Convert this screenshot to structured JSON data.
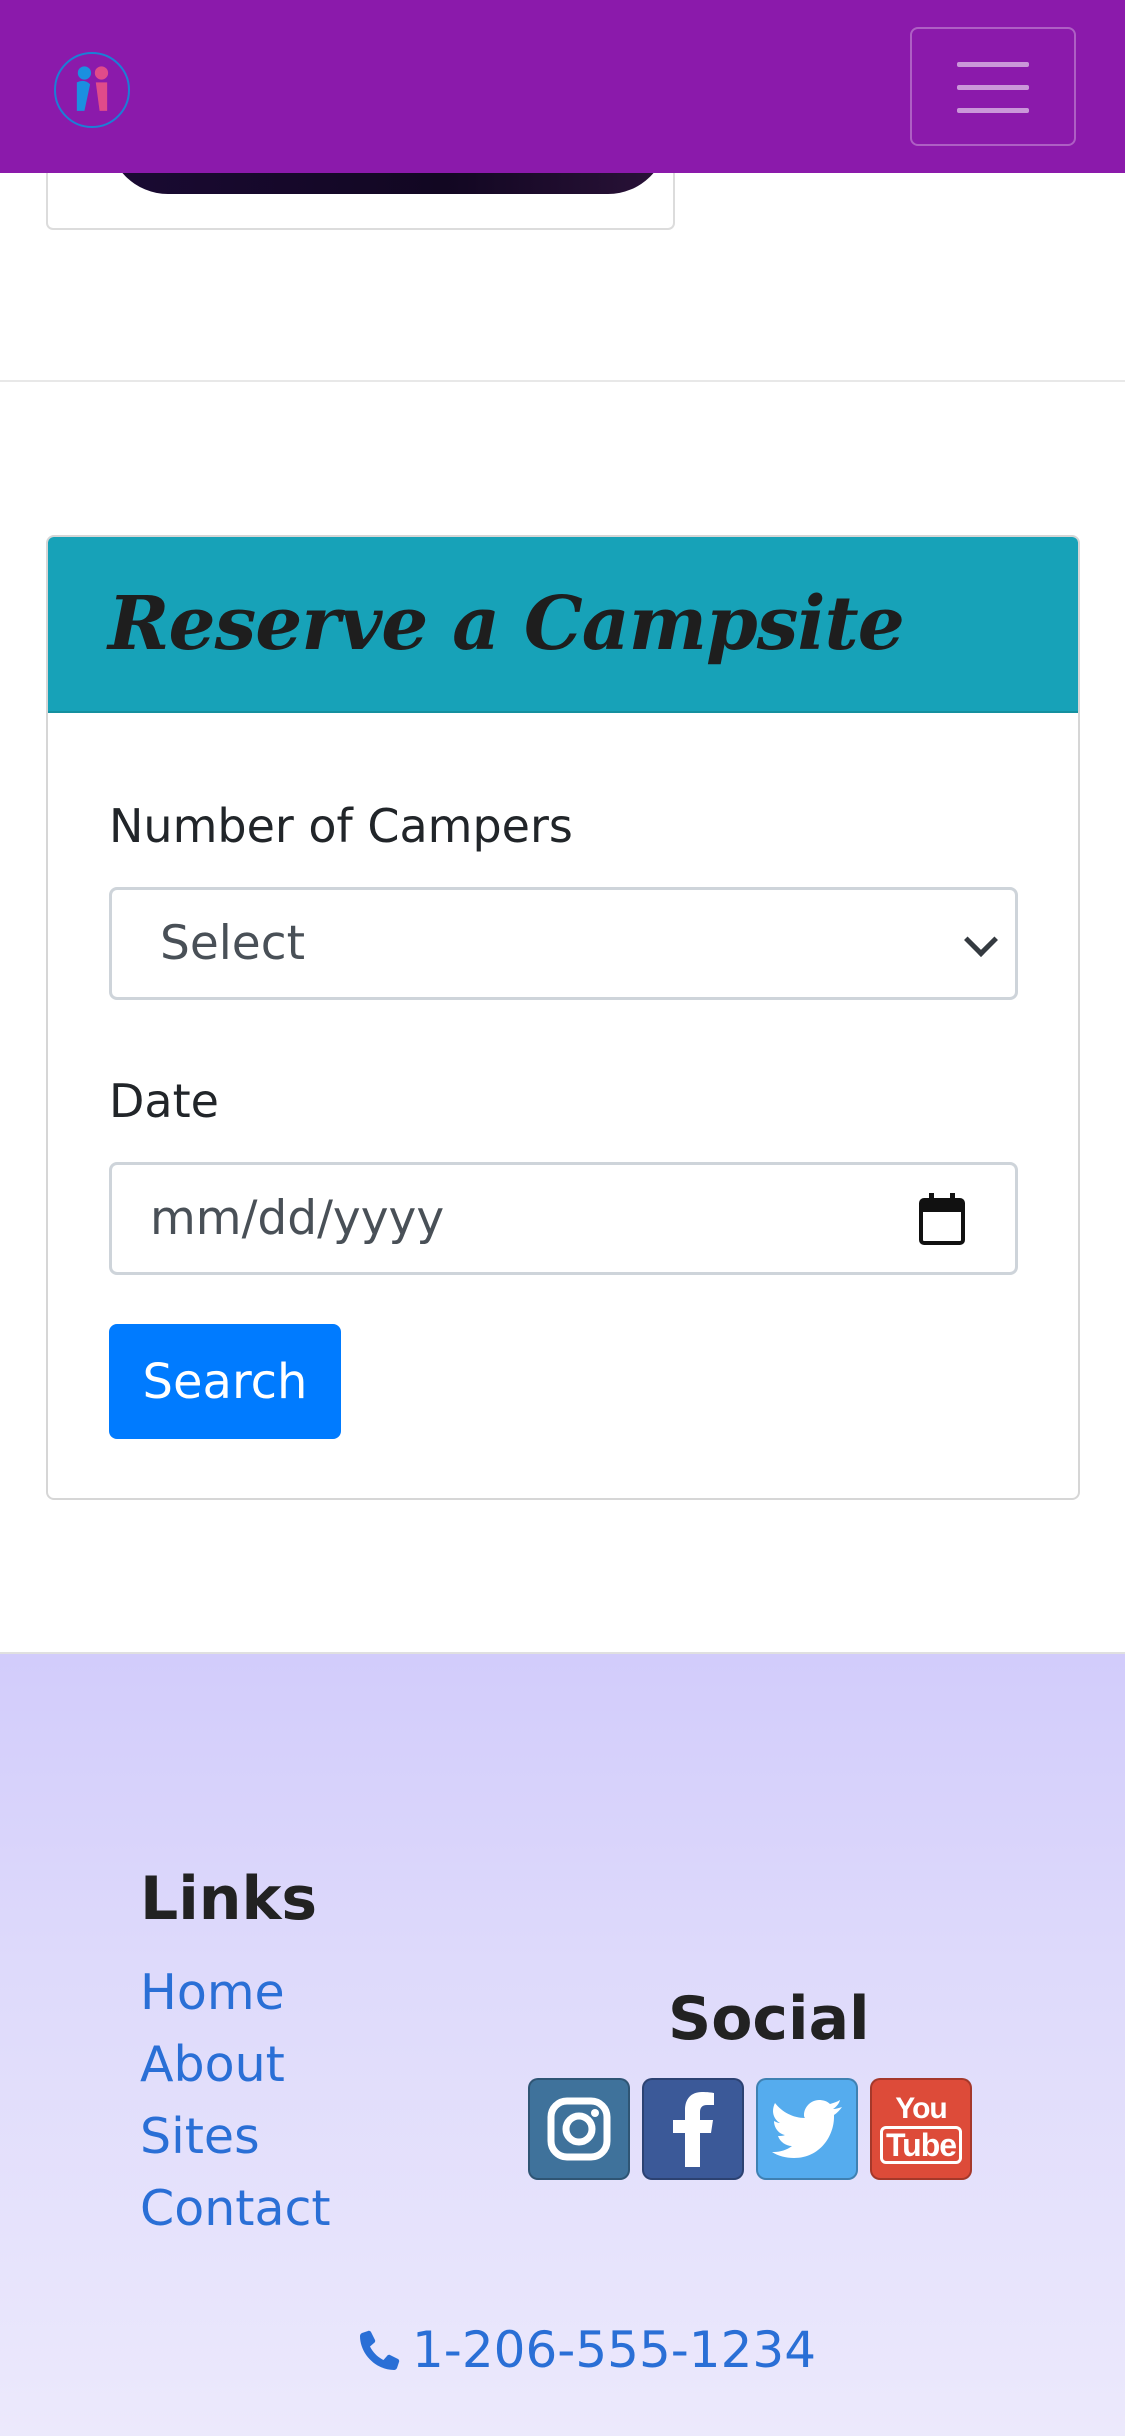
{
  "navbar": {
    "logo_icon": "brand-logo-icon",
    "menu_icon": "hamburger-icon",
    "background": "#8b1aab"
  },
  "reserve": {
    "title": "Reserve a Campsite",
    "header_color": "#17a2b8",
    "campers_label": "Number of Campers",
    "campers_value": "Select",
    "date_label": "Date",
    "date_placeholder": "mm/dd/yyyy",
    "search_label": "Search",
    "button_color": "#007bff"
  },
  "footer": {
    "links_heading": "Links",
    "links": [
      "Home",
      "About",
      "Sites",
      "Contact"
    ],
    "social_heading": "Social",
    "social": [
      {
        "name": "instagram-icon",
        "color": "#3f729b"
      },
      {
        "name": "facebook-icon",
        "color": "#3b5998"
      },
      {
        "name": "twitter-icon",
        "color": "#55acee"
      },
      {
        "name": "youtube-icon",
        "color": "#dd4b39",
        "text_top": "You",
        "text_bottom": "Tube"
      }
    ],
    "phone": "1-206-555-1234",
    "link_color": "#2a6fd6"
  }
}
